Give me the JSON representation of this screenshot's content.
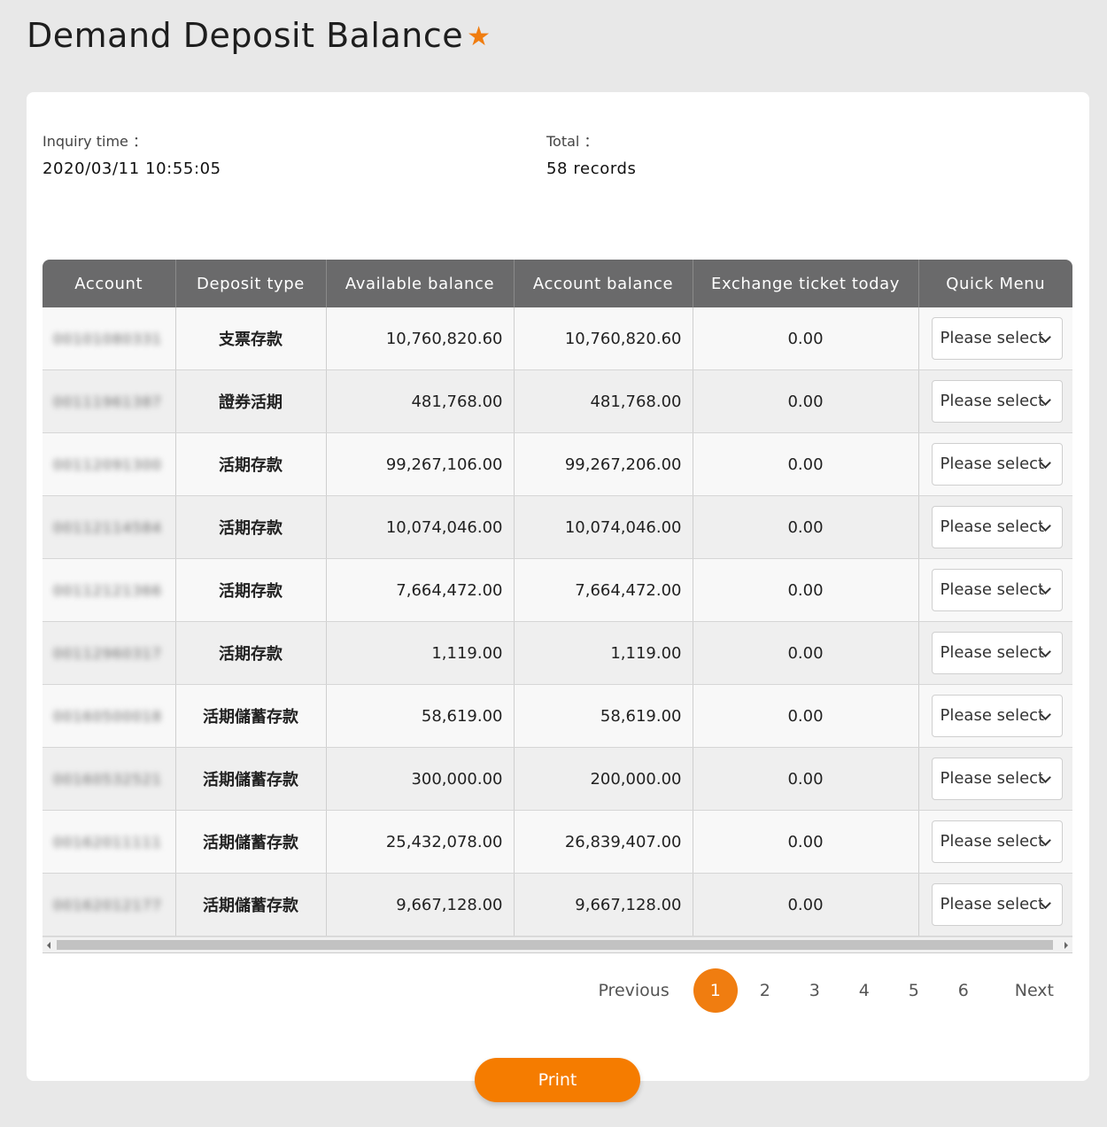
{
  "page": {
    "title": "Demand Deposit Balance",
    "star_color": "#f07d10"
  },
  "info": {
    "inquiry_label": "Inquiry time ：",
    "inquiry_value": "2020/03/11 10:55:05",
    "total_label": "Total ：",
    "total_value": "58 records"
  },
  "table": {
    "headers": [
      "Account",
      "Deposit type",
      "Available balance",
      "Account balance",
      "Exchange ticket today",
      "Quick Menu"
    ],
    "rows": [
      {
        "account": "00101080331",
        "type": "支票存款",
        "available": "10,760,820.60",
        "balance": "10,760,820.60",
        "exchange": "0.00",
        "menu": "Please select"
      },
      {
        "account": "00111961387",
        "type": "證券活期",
        "available": "481,768.00",
        "balance": "481,768.00",
        "exchange": "0.00",
        "menu": "Please select"
      },
      {
        "account": "00112091300",
        "type": "活期存款",
        "available": "99,267,106.00",
        "balance": "99,267,206.00",
        "exchange": "0.00",
        "menu": "Please select"
      },
      {
        "account": "00112114584",
        "type": "活期存款",
        "available": "10,074,046.00",
        "balance": "10,074,046.00",
        "exchange": "0.00",
        "menu": "Please select"
      },
      {
        "account": "00112121366",
        "type": "活期存款",
        "available": "7,664,472.00",
        "balance": "7,664,472.00",
        "exchange": "0.00",
        "menu": "Please select"
      },
      {
        "account": "00112960317",
        "type": "活期存款",
        "available": "1,119.00",
        "balance": "1,119.00",
        "exchange": "0.00",
        "menu": "Please select"
      },
      {
        "account": "00160500018",
        "type": "活期儲蓄存款",
        "available": "58,619.00",
        "balance": "58,619.00",
        "exchange": "0.00",
        "menu": "Please select"
      },
      {
        "account": "00160532521",
        "type": "活期儲蓄存款",
        "available": "300,000.00",
        "balance": "200,000.00",
        "exchange": "0.00",
        "menu": "Please select"
      },
      {
        "account": "00162011111",
        "type": "活期儲蓄存款",
        "available": "25,432,078.00",
        "balance": "26,839,407.00",
        "exchange": "0.00",
        "menu": "Please select"
      },
      {
        "account": "00162012177",
        "type": "活期儲蓄存款",
        "available": "9,667,128.00",
        "balance": "9,667,128.00",
        "exchange": "0.00",
        "menu": "Please select"
      }
    ]
  },
  "pagination": {
    "previous": "Previous",
    "next": "Next",
    "pages": [
      "1",
      "2",
      "3",
      "4",
      "5",
      "6"
    ],
    "current": "1",
    "accent": "#f07d10"
  },
  "actions": {
    "print": "Print",
    "print_color": "#f57c00"
  }
}
